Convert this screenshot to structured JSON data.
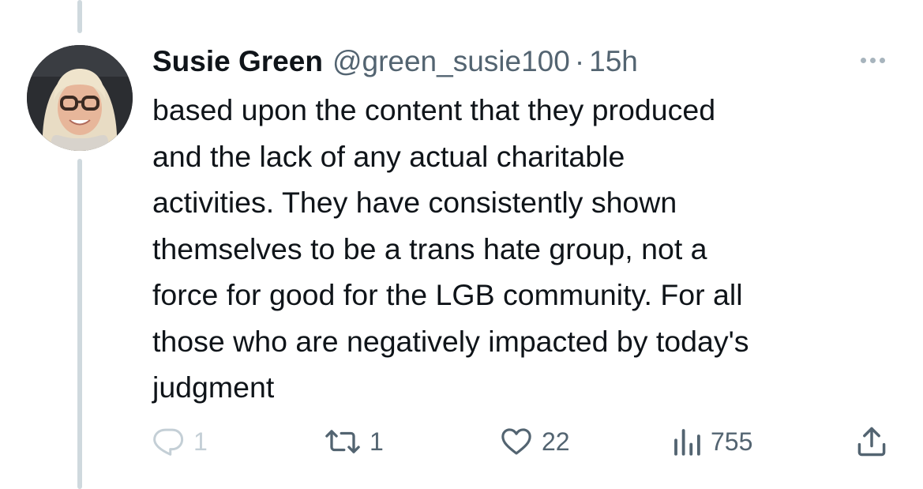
{
  "tweet": {
    "display_name": "Susie Green",
    "handle": "@green_susie100",
    "separator": "·",
    "time": "15h",
    "text": "based upon the content that they produced\nand the lack of any actual charitable\nactivities. They have consistently shown\nthemselves to be a trans hate group, not a\nforce for good for the LGB community. For all\nthose who are negatively impacted by today's\njudgment"
  },
  "avatar": {
    "description": "profile-photo"
  },
  "actions": {
    "reply_count": "1",
    "retweet_count": "1",
    "like_count": "22",
    "view_count": "755"
  },
  "icons": {
    "more": "more-horizontal-icon",
    "reply": "reply-icon",
    "retweet": "retweet-icon",
    "like": "heart-icon",
    "views": "views-bar-chart-icon",
    "share": "share-icon"
  },
  "colors": {
    "text": "#0f1419",
    "secondary": "#536471",
    "thread_line": "#cfd9de",
    "disabled_icon": "#c4cfd6"
  }
}
